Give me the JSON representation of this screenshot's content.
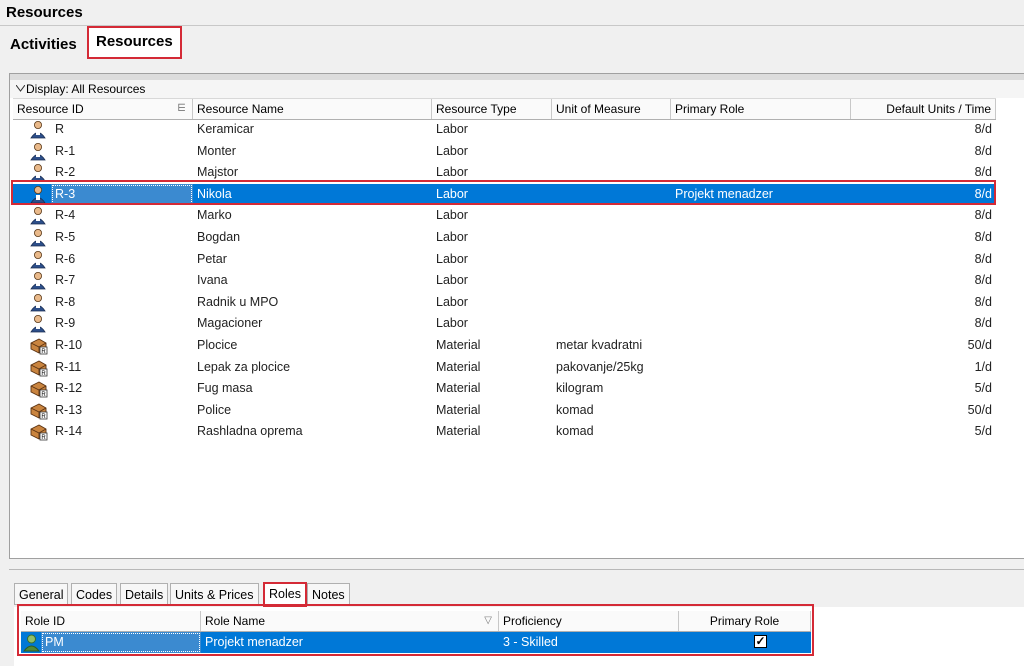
{
  "window_title": "Resources",
  "top_tabs": [
    {
      "label": "Activities"
    },
    {
      "label": "Resources"
    }
  ],
  "display_label": "Display: All Resources",
  "columns": [
    "Resource ID",
    "Resource Name",
    "Resource Type",
    "Unit of Measure",
    "Primary Role",
    "Default Units / Time"
  ],
  "resources": [
    {
      "id": "R",
      "name": "Keramicar",
      "type": "Labor",
      "uom": "",
      "role": "",
      "units": "8/d",
      "kind": "labor"
    },
    {
      "id": "R-1",
      "name": "Monter",
      "type": "Labor",
      "uom": "",
      "role": "",
      "units": "8/d",
      "kind": "labor"
    },
    {
      "id": "R-2",
      "name": "Majstor",
      "type": "Labor",
      "uom": "",
      "role": "",
      "units": "8/d",
      "kind": "labor"
    },
    {
      "id": "R-3",
      "name": "Nikola",
      "type": "Labor",
      "uom": "",
      "role": "Projekt menadzer",
      "units": "8/d",
      "kind": "labor",
      "selected": true
    },
    {
      "id": "R-4",
      "name": "Marko",
      "type": "Labor",
      "uom": "",
      "role": "",
      "units": "8/d",
      "kind": "labor"
    },
    {
      "id": "R-5",
      "name": "Bogdan",
      "type": "Labor",
      "uom": "",
      "role": "",
      "units": "8/d",
      "kind": "labor"
    },
    {
      "id": "R-6",
      "name": "Petar",
      "type": "Labor",
      "uom": "",
      "role": "",
      "units": "8/d",
      "kind": "labor"
    },
    {
      "id": "R-7",
      "name": "Ivana",
      "type": "Labor",
      "uom": "",
      "role": "",
      "units": "8/d",
      "kind": "labor"
    },
    {
      "id": "R-8",
      "name": "Radnik u MPO",
      "type": "Labor",
      "uom": "",
      "role": "",
      "units": "8/d",
      "kind": "labor"
    },
    {
      "id": "R-9",
      "name": "Magacioner",
      "type": "Labor",
      "uom": "",
      "role": "",
      "units": "8/d",
      "kind": "labor"
    },
    {
      "id": "R-10",
      "name": "Plocice",
      "type": "Material",
      "uom": "metar kvadratni",
      "role": "",
      "units": "50/d",
      "kind": "material"
    },
    {
      "id": "R-11",
      "name": "Lepak za plocice",
      "type": "Material",
      "uom": "pakovanje/25kg",
      "role": "",
      "units": "1/d",
      "kind": "material"
    },
    {
      "id": "R-12",
      "name": "Fug masa",
      "type": "Material",
      "uom": "kilogram",
      "role": "",
      "units": "5/d",
      "kind": "material"
    },
    {
      "id": "R-13",
      "name": "Police",
      "type": "Material",
      "uom": "komad",
      "role": "",
      "units": "50/d",
      "kind": "material"
    },
    {
      "id": "R-14",
      "name": "Rashladna oprema",
      "type": "Material",
      "uom": "komad",
      "role": "",
      "units": "5/d",
      "kind": "material"
    }
  ],
  "detail_tabs": [
    "General",
    "Codes",
    "Details",
    "Units & Prices",
    "Roles",
    "Notes"
  ],
  "roles_columns": [
    "Role ID",
    "Role Name",
    "Proficiency",
    "Primary Role"
  ],
  "roles_rows": [
    {
      "role_id": "PM",
      "role_name": "Projekt menadzer",
      "proficiency": "3 - Skilled",
      "primary": true
    }
  ],
  "colors": {
    "selection": "#0078d7",
    "highlight": "#d42a36"
  }
}
